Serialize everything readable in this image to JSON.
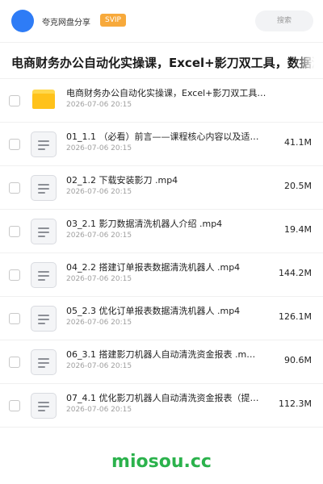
{
  "header": {
    "user_name": "夸克网盘分享",
    "badge": "SVIP",
    "search_placeholder": "搜索"
  },
  "share_title": "电商财务办公自动化实操课，Excel+影刀双工具，数据清洗",
  "files": [
    {
      "type": "folder",
      "name": "电商财务办公自动化实操课，Excel+影刀双工具，…",
      "date": "2026-07-06 20:15",
      "size": ""
    },
    {
      "type": "file",
      "name": "01_1.1 （必看）前言——课程核心内容以及适合…",
      "date": "2026-07-06 20:15",
      "size": "41.1M"
    },
    {
      "type": "file",
      "name": "02_1.2 下载安装影刀 .mp4",
      "date": "2026-07-06 20:15",
      "size": "20.5M"
    },
    {
      "type": "file",
      "name": "03_2.1 影刀数据清洗机器人介绍 .mp4",
      "date": "2026-07-06 20:15",
      "size": "19.4M"
    },
    {
      "type": "file",
      "name": "04_2.2 搭建订单报表数据清洗机器人 .mp4",
      "date": "2026-07-06 20:15",
      "size": "144.2M"
    },
    {
      "type": "file",
      "name": "05_2.3 优化订单报表数据清洗机器人 .mp4",
      "date": "2026-07-06 20:15",
      "size": "126.1M"
    },
    {
      "type": "file",
      "name": "06_3.1 搭建影刀机器人自动清洗资金报表 .m…",
      "date": "2026-07-06 20:15",
      "size": "90.6M"
    },
    {
      "type": "file",
      "name": "07_4.1 优化影刀机器人自动清洗资金报表（提取…",
      "date": "2026-07-06 20:15",
      "size": "112.3M"
    }
  ],
  "watermark": "miosou.cc",
  "colors": {
    "accent": "#2e7cf6",
    "badge": "#f7a93b",
    "watermark": "#2bb24c",
    "folder": "#ffc21a"
  }
}
